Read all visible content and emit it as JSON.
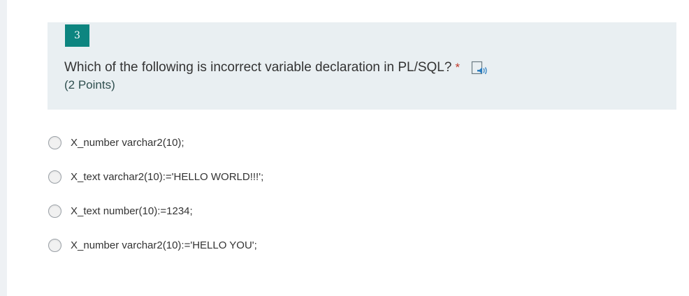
{
  "question": {
    "number": "3",
    "title": "Which of the following is incorrect variable declaration in PL/SQL?",
    "required_marker": "*",
    "points": "(2 Points)",
    "icon": "speaker-icon"
  },
  "options": [
    {
      "label": "X_number varchar2(10);"
    },
    {
      "label": "X_text varchar2(10):='HELLO WORLD!!!';"
    },
    {
      "label": "X_text number(10):=1234;"
    },
    {
      "label": "X_number varchar2(10):='HELLO YOU';"
    }
  ],
  "colors": {
    "accent": "#0d8580",
    "header_bg": "#e9eff2",
    "required": "#c0392b"
  }
}
